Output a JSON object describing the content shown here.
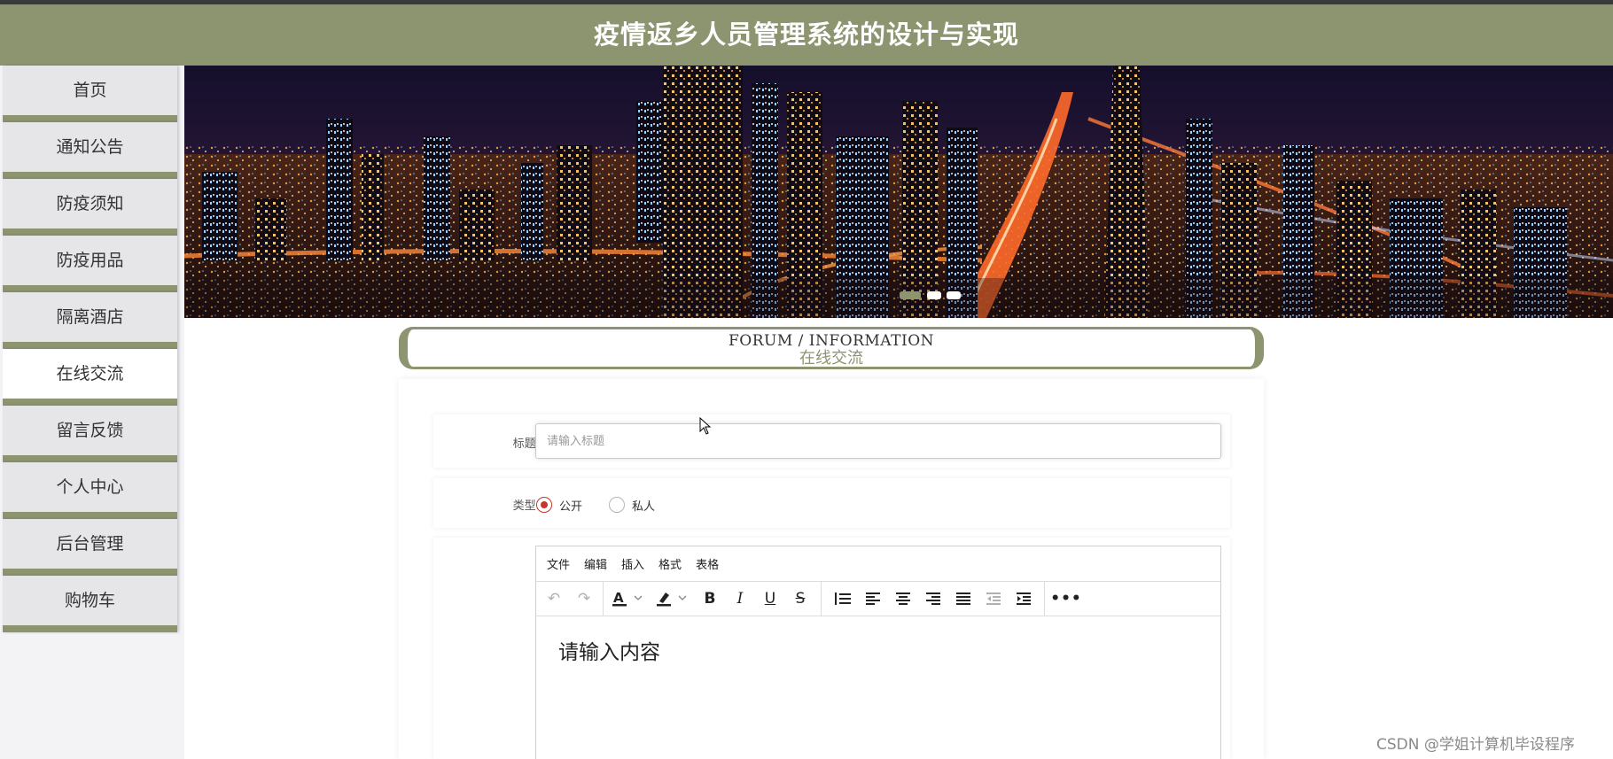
{
  "header": {
    "title": "疫情返乡人员管理系统的设计与实现"
  },
  "sidebar": {
    "items": [
      {
        "label": "首页"
      },
      {
        "label": "通知公告"
      },
      {
        "label": "防疫须知"
      },
      {
        "label": "防疫用品"
      },
      {
        "label": "隔离酒店"
      },
      {
        "label": "在线交流",
        "active": true
      },
      {
        "label": "留言反馈"
      },
      {
        "label": "个人中心"
      },
      {
        "label": "后台管理"
      },
      {
        "label": "购物车"
      }
    ]
  },
  "banner": {
    "slide_count": 3,
    "active_slide": 1
  },
  "forum": {
    "title_en": "FORUM / INFORMATION",
    "title_zh": "在线交流"
  },
  "form": {
    "title_label": "标题:",
    "title_placeholder": "请输入标题",
    "title_value": "",
    "type_label": "类型:",
    "type_options": [
      {
        "label": "公开",
        "checked": true
      },
      {
        "label": "私人",
        "checked": false
      }
    ]
  },
  "editor": {
    "menus": [
      "文件",
      "编辑",
      "插入",
      "格式",
      "表格"
    ],
    "placeholder": "请输入内容",
    "toolbar": [
      "undo-icon",
      "redo-icon",
      "text-color-icon",
      "highlight-color-icon",
      "bold-icon",
      "italic-icon",
      "underline-icon",
      "strikethrough-icon",
      "line-height-icon",
      "align-left-icon",
      "align-center-icon",
      "align-right-icon",
      "align-justify-icon",
      "outdent-icon",
      "indent-icon",
      "more-icon"
    ]
  },
  "watermark": "CSDN @学姐计算机毕设程序",
  "colors": {
    "accent": "#8c9470",
    "radio_checked": "#c0392b"
  }
}
